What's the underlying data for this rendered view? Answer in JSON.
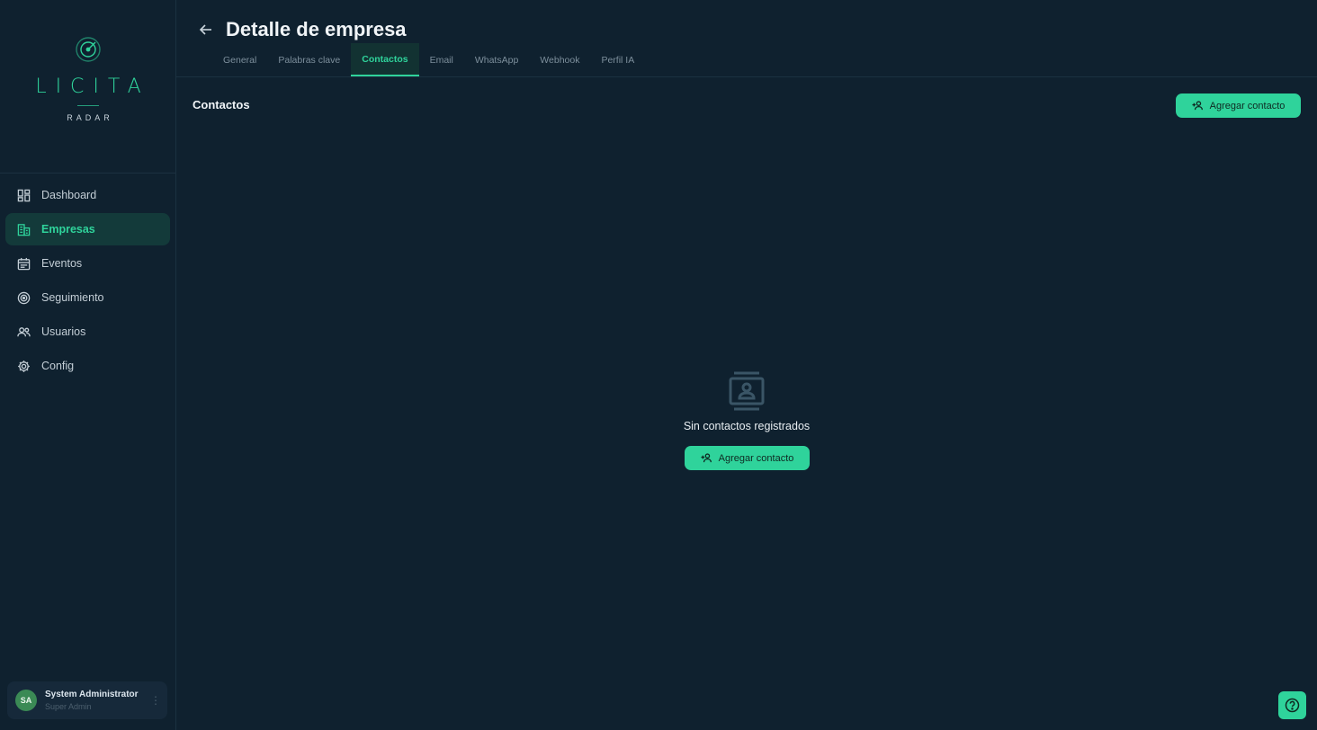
{
  "brand": {
    "word": "LICITA",
    "sub": "RADAR",
    "accent_color": "#2fd39b",
    "icon": "radar-icon"
  },
  "sidebar": {
    "items": [
      {
        "label": "Dashboard",
        "icon": "dashboard-icon",
        "active": false
      },
      {
        "label": "Empresas",
        "icon": "building-icon",
        "active": true
      },
      {
        "label": "Eventos",
        "icon": "calendar-icon",
        "active": false
      },
      {
        "label": "Seguimiento",
        "icon": "target-icon",
        "active": false
      },
      {
        "label": "Usuarios",
        "icon": "users-icon",
        "active": false
      },
      {
        "label": "Config",
        "icon": "gear-icon",
        "active": false
      }
    ]
  },
  "user": {
    "initials": "SA",
    "name": "System Administrator",
    "role": "Super Admin"
  },
  "header": {
    "title": "Detalle de empresa",
    "tabs": [
      {
        "label": "General",
        "active": false
      },
      {
        "label": "Palabras clave",
        "active": false
      },
      {
        "label": "Contactos",
        "active": true
      },
      {
        "label": "Email",
        "active": false
      },
      {
        "label": "WhatsApp",
        "active": false
      },
      {
        "label": "Webhook",
        "active": false
      },
      {
        "label": "Perfil IA",
        "active": false
      }
    ]
  },
  "main": {
    "section_title": "Contactos",
    "add_button_label": "Agregar contacto",
    "empty_state": {
      "icon": "contact-card-icon",
      "message": "Sin contactos registrados",
      "button_label": "Agregar contacto"
    }
  },
  "help": {
    "icon": "help-icon"
  }
}
